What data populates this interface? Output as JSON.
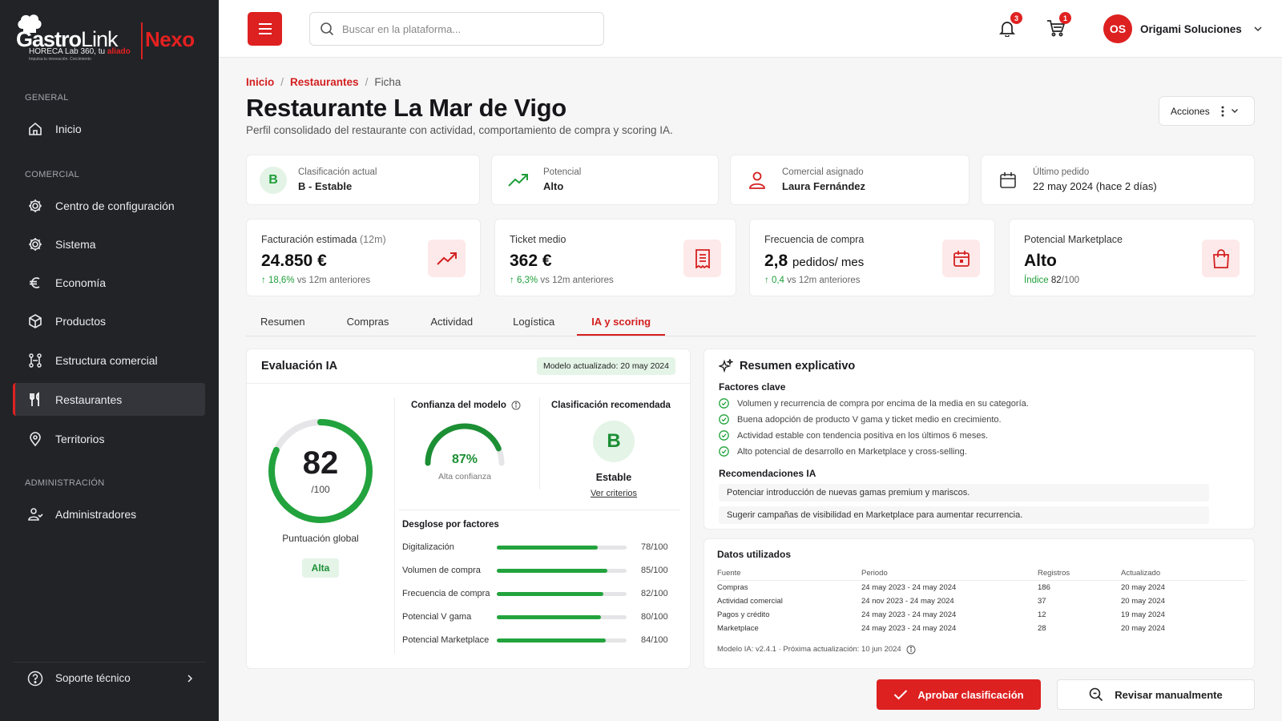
{
  "brand": {
    "name_bold": "Gastro",
    "name_light": "Link",
    "product": "Nexo",
    "tagline_pre": "HORECA Lab 360, tu ",
    "tagline_em": "aliado",
    "tagline_small": "Impulsa tu innovación. Crecimiento"
  },
  "sidebar": {
    "sections": {
      "general": "GENERAL",
      "comercial": "COMERCIAL",
      "admin": "ADMINISTRACIÓN"
    },
    "items": [
      {
        "label": "Inicio"
      },
      {
        "label": "Centro de configuración"
      },
      {
        "label": "Sistema"
      },
      {
        "label": "Economía"
      },
      {
        "label": "Productos"
      },
      {
        "label": "Estructura comercial"
      },
      {
        "label": "Restaurantes"
      },
      {
        "label": "Territorios"
      },
      {
        "label": "Administradores"
      }
    ],
    "support": "Soporte técnico"
  },
  "topbar": {
    "search_placeholder": "Buscar en la plataforma...",
    "notifications_count": "3",
    "cart_count": "1",
    "user_initials": "OS",
    "user_name": "Origami Soluciones"
  },
  "breadcrumb": {
    "home": "Inicio",
    "section": "Restaurantes",
    "current": "Ficha",
    "sep": "/"
  },
  "page": {
    "title": "Restaurante La Mar de Vigo",
    "subtitle": "Perfil consolidado del restaurante con actividad, comportamiento de compra y scoring IA.",
    "actions_label": "Acciones"
  },
  "info_cards": [
    {
      "label": "Clasificación actual",
      "value": "B - Estable",
      "badge": "B"
    },
    {
      "label": "Potencial",
      "value": "Alto"
    },
    {
      "label": "Comercial asignado",
      "value": "Laura Fernández"
    },
    {
      "label": "Último pedido",
      "value": "22 may 2024 (hace 2 días)"
    }
  ],
  "kpis": [
    {
      "label": "Facturación estimada",
      "label_suffix": "(12m)",
      "value": "24.850 €",
      "delta": "↑ 18,6%",
      "foot": "vs 12m anteriores"
    },
    {
      "label": "Ticket medio",
      "value": "362 €",
      "delta": "↑ 6,3%",
      "foot": "vs 12m anteriores"
    },
    {
      "label": "Frecuencia de compra",
      "value": "2,8",
      "value_unit": "pedidos/ mes",
      "delta": "↑ 0,4",
      "foot": "vs 12m anteriores"
    },
    {
      "label": "Potencial Marketplace",
      "value": "Alto",
      "delta": "Índice",
      "foot_value": "82",
      "foot_suffix": "/100"
    }
  ],
  "tabs": [
    "Resumen",
    "Compras",
    "Actividad",
    "Logística",
    "IA y scoring"
  ],
  "evaluation": {
    "title": "Evaluación IA",
    "model_badge": "Modelo actualizado: 20 may 2024",
    "score": "82",
    "score_max": "/100",
    "score_fraction": 0.82,
    "score_label": "Puntuación global",
    "score_level": "Alta",
    "confidence_title": "Confianza del modelo",
    "confidence_value": "87%",
    "confidence_fraction": 0.87,
    "confidence_label": "Alta confianza",
    "recommended_title": "Clasificación recomendada",
    "recommended_badge": "B",
    "recommended_label": "Estable",
    "criteria_link": "Ver criterios",
    "breakdown_title": "Desglose por factores",
    "factors": [
      {
        "name": "Digitalización",
        "value": 78,
        "text": "78/100"
      },
      {
        "name": "Volumen de compra",
        "value": 85,
        "text": "85/100"
      },
      {
        "name": "Frecuencia de compra",
        "value": 82,
        "text": "82/100"
      },
      {
        "name": "Potencial V gama",
        "value": 80,
        "text": "80/100"
      },
      {
        "name": "Potencial Marketplace",
        "value": 84,
        "text": "84/100"
      }
    ]
  },
  "summary": {
    "title": "Resumen explicativo",
    "factors_title": "Factores clave",
    "factors": [
      "Volumen y recurrencia de compra por encima de la media en su categoría.",
      "Buena adopción de producto V gama y ticket medio en crecimiento.",
      "Actividad estable con tendencia positiva en los últimos 6 meses.",
      "Alto potencial de desarrollo en Marketplace y cross-selling."
    ],
    "recs_title": "Recomendaciones IA",
    "recs": [
      "Potenciar introducción de nuevas gamas premium y mariscos.",
      "Sugerir campañas de visibilidad en Marketplace para aumentar recurrencia."
    ]
  },
  "data_used": {
    "title": "Datos utilizados",
    "headers": [
      "Fuente",
      "Periodo",
      "Registros",
      "Actualizado"
    ],
    "rows": [
      [
        "Compras",
        "24 may 2023 - 24 may 2024",
        "186",
        "20 may 2024"
      ],
      [
        "Actividad comercial",
        "24 nov 2023 - 24 may 2024",
        "37",
        "20 may 2024"
      ],
      [
        "Pagos y crédito",
        "24 may 2023 - 24 may 2024",
        "12",
        "19 may 2024"
      ],
      [
        "Marketplace",
        "24 may 2023 - 24 may 2024",
        "28",
        "20 may 2024"
      ]
    ],
    "model_note": "Modelo IA: v2.4.1 · Próxima actualización: 10 jun 2024"
  },
  "buttons": {
    "approve": "Aprobar clasificación",
    "review": "Revisar manualmente"
  },
  "colors": {
    "accent": "#dd2020",
    "success": "#22a33d",
    "sidebar": "#222327"
  }
}
